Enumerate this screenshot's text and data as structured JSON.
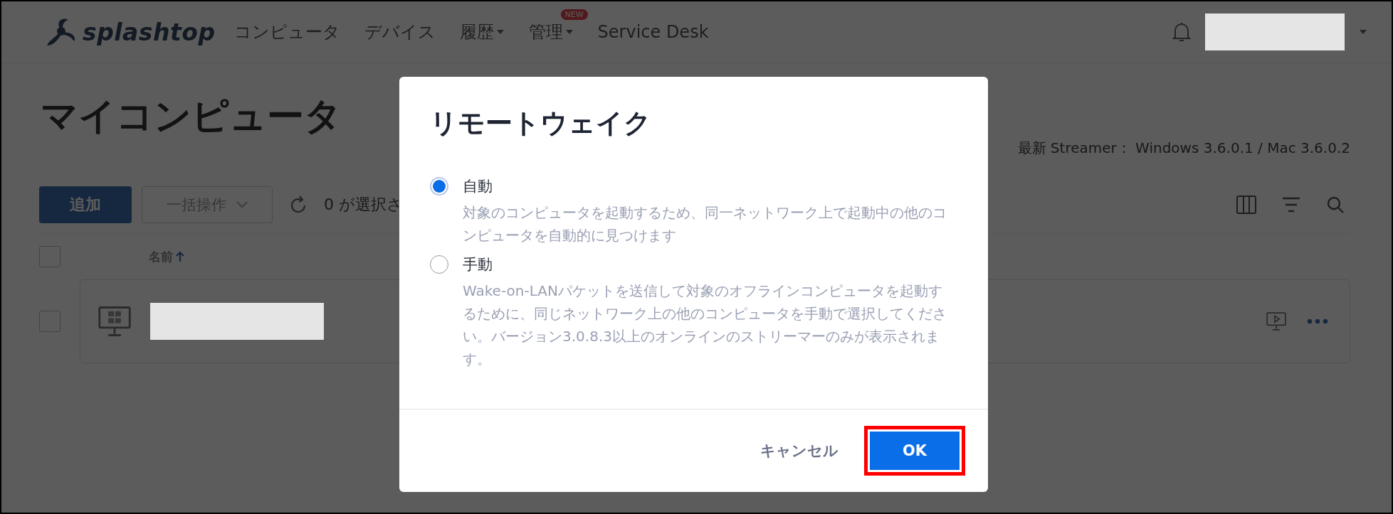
{
  "nav": {
    "logo": "splashtop",
    "items": [
      {
        "label": "コンピュータ",
        "dropdown": false
      },
      {
        "label": "デバイス",
        "dropdown": false
      },
      {
        "label": "履歴",
        "dropdown": true
      },
      {
        "label": "管理",
        "dropdown": true,
        "badge": "NEW"
      },
      {
        "label": "Service Desk",
        "dropdown": false
      }
    ]
  },
  "page": {
    "title": "マイコンピュータ",
    "streamer_info": "最新 Streamer： Windows 3.6.0.1 / Mac 3.6.0.2"
  },
  "toolbar": {
    "add_button": "追加",
    "bulk_button": "一括操作",
    "selection_text": "0 が選択さ"
  },
  "table": {
    "header": {
      "checked": false,
      "column": "名前"
    },
    "rows": [
      {
        "checked": false
      }
    ]
  },
  "dialog": {
    "title": "リモートウェイク",
    "options": [
      {
        "label": "自動",
        "description": "対象のコンピュータを起動するため、同一ネットワーク上で起動中の他のコンピュータを自動的に見つけます",
        "selected": true
      },
      {
        "label": "手動",
        "description": "Wake-on-LANパケットを送信して対象のオフラインコンピュータを起動するために、同じネットワーク上の他のコンピュータを手動で選択してください。バージョン3.0.8.3以上のオンラインのストリーマーのみが表示されます。",
        "selected": false
      }
    ],
    "cancel": "キャンセル",
    "ok": {
      "label": "OK",
      "highlighted": true
    }
  }
}
